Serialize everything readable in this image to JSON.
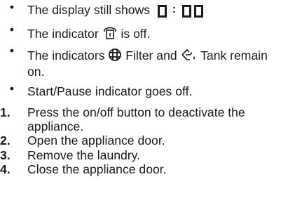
{
  "bullets": [
    {
      "marker": "•",
      "text_before": "The display still shows",
      "display": [
        "0",
        ":",
        "0",
        "0"
      ]
    },
    {
      "marker": "•",
      "text_before": "The indicator",
      "icon": "door-lock-icon",
      "text_after": "is off."
    },
    {
      "marker": "•",
      "text_before": "The indicators",
      "icon1": "filter-icon",
      "text_mid": "Filter and",
      "icon2": "tank-icon",
      "text_after": "Tank remain on."
    },
    {
      "marker": "•",
      "text": "Start/Pause indicator goes off."
    }
  ],
  "steps": [
    {
      "number": "1.",
      "text": "Press the on/off button to deactivate the appliance."
    },
    {
      "number": "2.",
      "text": "Open the appliance door."
    },
    {
      "number": "3.",
      "text": "Remove the laundry."
    },
    {
      "number": "4.",
      "text": "Close the appliance door."
    }
  ]
}
